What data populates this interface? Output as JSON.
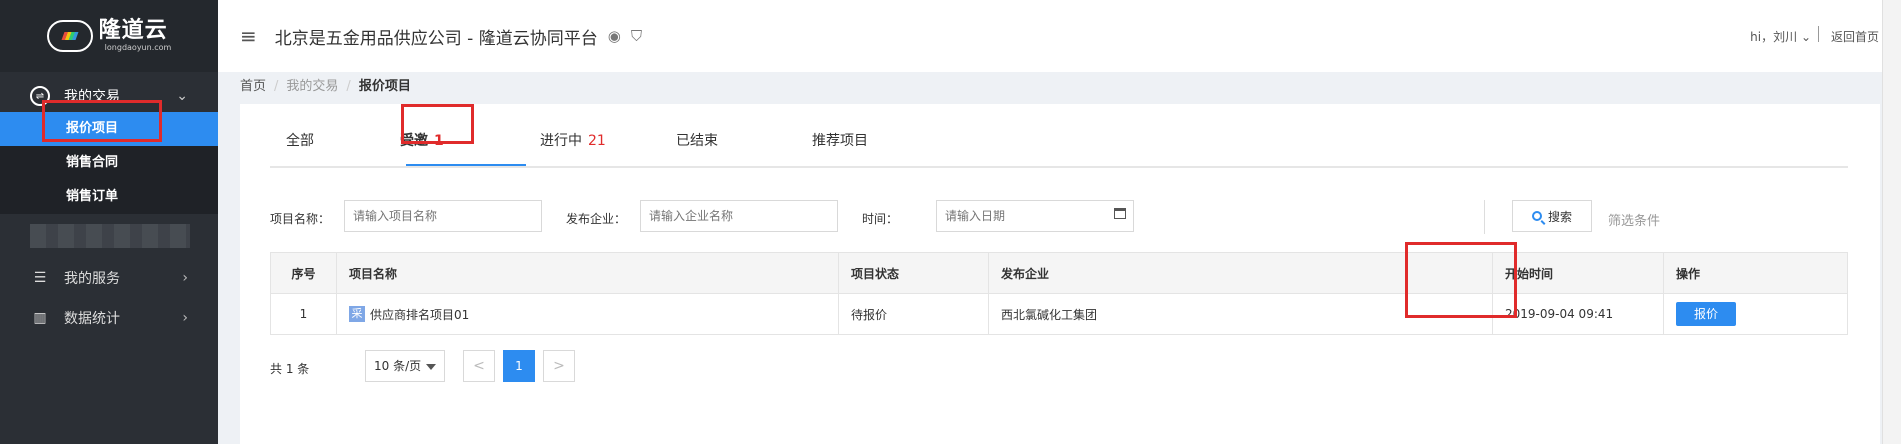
{
  "brand": {
    "name": "隆道云",
    "domain": "longdaoyun.com"
  },
  "sidebar": {
    "group_my_trade": "我的交易",
    "subitems": [
      "报价项目",
      "销售合同",
      "销售订单"
    ],
    "my_services": "我的服务",
    "statistics": "数据统计"
  },
  "header": {
    "title": "北京是五金用品供应公司 - 隆道云协同平台",
    "user": "hi，刘川",
    "back": "返回首页"
  },
  "breadcrumb": [
    "首页",
    "我的交易",
    "报价项目"
  ],
  "tabs": [
    {
      "label": "全部",
      "count": ""
    },
    {
      "label": "受邀",
      "count": "1"
    },
    {
      "label": "进行中",
      "count": "21"
    },
    {
      "label": "已结束",
      "count": ""
    },
    {
      "label": "推荐项目",
      "count": ""
    }
  ],
  "filters": {
    "project_name_label": "项目名称：",
    "project_name_placeholder": "请输入项目名称",
    "company_label": "发布企业：",
    "company_placeholder": "请输入企业名称",
    "time_label": "时间：",
    "time_placeholder": "请输入日期",
    "search_label": "搜索",
    "filter_link": "筛选条件"
  },
  "table": {
    "headers": [
      "序号",
      "项目名称",
      "项目状态",
      "发布企业",
      "开始时间",
      "操作"
    ],
    "rows": [
      {
        "index": "1",
        "tag": "采",
        "name": "供应商排名项目01",
        "status": "待报价",
        "company": "西北氯碱化工集团",
        "start": "2019-09-04 09:41",
        "action": "报价"
      }
    ]
  },
  "pager": {
    "total": "共 1 条",
    "page_size": "10 条/页",
    "prev": "<",
    "current": "1",
    "next": ">"
  },
  "colors": {
    "accent": "#2d8cf0",
    "highlight": "#e02b2b",
    "sidebar": "#2b2f35"
  }
}
